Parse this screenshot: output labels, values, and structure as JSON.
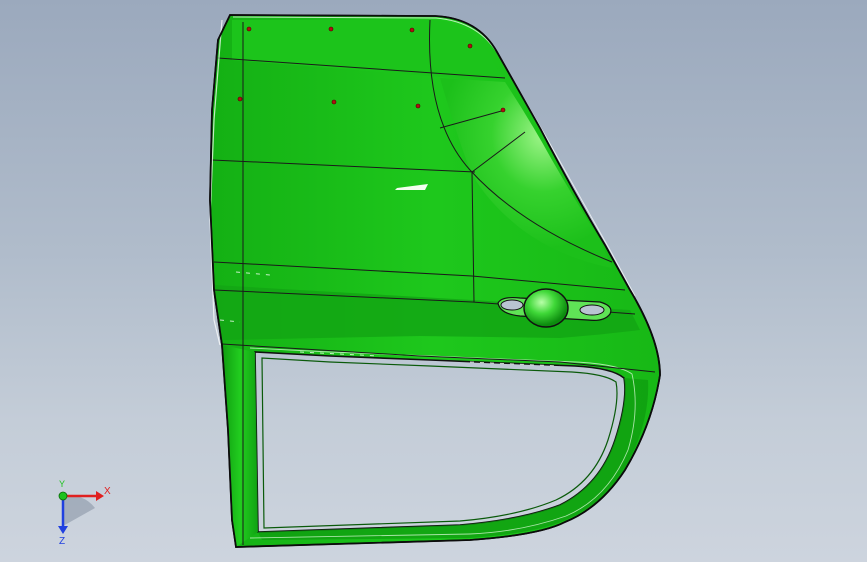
{
  "viewport": {
    "background_top": "#9ba9bd",
    "background_bottom": "#cdd4de"
  },
  "model": {
    "part_name": "car-door-panel",
    "surface_color": "#1dc41a",
    "surface_color_dark": "#0e8f10",
    "surface_highlight": "#8ff27a",
    "edge_color": "#111111",
    "handle": "door-handle"
  },
  "triad": {
    "x_label": "X",
    "y_label": "Y",
    "z_label": "Z",
    "x_color": "#e02020",
    "y_color": "#1ec21e",
    "z_color": "#2040e0"
  }
}
